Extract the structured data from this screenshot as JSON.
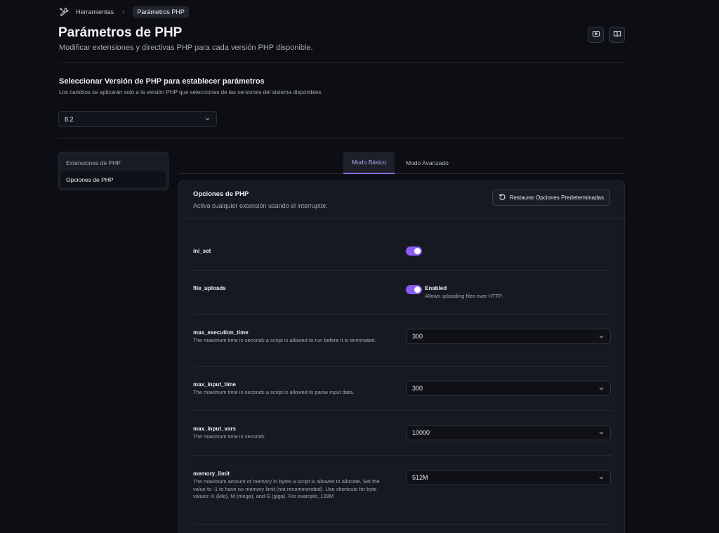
{
  "breadcrumb": {
    "items": [
      "Herramientas",
      "Parámetros PHP"
    ]
  },
  "header": {
    "title": "Parámetros de PHP",
    "subtitle": "Modificar extensiones y directivas PHP para cada versión PHP disponible."
  },
  "top_actions": {
    "icons": [
      "video-icon",
      "book-icon"
    ]
  },
  "version": {
    "title": "Seleccionar Versión de PHP para establecer parámetros",
    "description": "Los cambios se aplicarán solo a la versión PHP que selecciones de las versiones del sistema disponibles.",
    "selected": "8.2"
  },
  "sidebar": {
    "items": [
      {
        "label": "Extensiones de PHP",
        "active": false
      },
      {
        "label": "Opciones de PHP",
        "active": true
      }
    ]
  },
  "tabs": [
    {
      "label": "Modo Básico",
      "active": true
    },
    {
      "label": "Modo Avanzado",
      "active": false
    }
  ],
  "panel": {
    "title": "Opciones de PHP",
    "description": "Activa cualquier extensión usando el interruptor.",
    "restore_label": "Restaurar Opciones Predeterminadas"
  },
  "options": {
    "ini_set": {
      "name": "ini_set",
      "enabled": true
    },
    "file_uploads": {
      "name": "file_uploads",
      "enabled": true,
      "status": "Enabled",
      "help": "Allows uploading files over HTTP."
    },
    "max_execution_time": {
      "name": "max_execution_time",
      "desc": "The maximum time in seconds a script is allowed to run before it is terminated.",
      "value": "300"
    },
    "max_input_time": {
      "name": "max_input_time",
      "desc": "The maximum time in seconds a script is allowed to parse input data.",
      "value": "300"
    },
    "max_input_vars": {
      "name": "max_input_vars",
      "desc": "The maximum time in seconds",
      "value": "10000"
    },
    "memory_limit": {
      "name": "memory_limit",
      "desc": "The maximum amount of memory in bytes a script is allowed to allocate. Set the value to -1 to have no memory limit (not recommended). Use shortcuts for byte values: K (kilo), M (mega), and G (giga). For example, 128M",
      "value": "512M"
    }
  },
  "colors": {
    "background": "#0d0e14",
    "panel": "#171922",
    "accent": "#8b5cf6",
    "active_tab_text": "#b9a6ff"
  }
}
